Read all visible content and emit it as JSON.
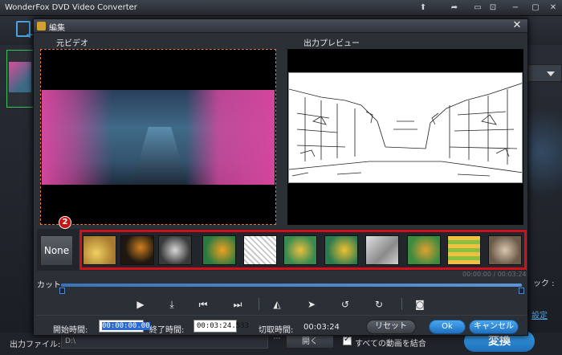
{
  "app": {
    "title": "WonderFox DVD Video Converter",
    "right_fragment": "ック :",
    "settings_link": "設定"
  },
  "bottom": {
    "output_label": "出力ファイル:",
    "output_path": "D:\\",
    "browse_label": "⋯",
    "open_label": "開く",
    "merge_label": "すべての動画を結合",
    "merge_checked": true,
    "convert_label": "変換"
  },
  "dialog": {
    "title": "編集",
    "close_label": "✕",
    "original_label": "元ビデオ",
    "preview_label": "出力プレビュー",
    "effects": {
      "none_label": "None",
      "badge": "2",
      "selected": "Edge",
      "thumb_icons": [
        "sepia-filter-icon",
        "dark-filter-icon",
        "grayscale-filter-icon",
        "vivid-filter-icon",
        "edge-filter-icon",
        "blur-filter-icon",
        "sharpen-filter-icon",
        "emboss-filter-icon",
        "noise-filter-icon",
        "mosaic-filter-icon",
        "aged-filter-icon"
      ]
    },
    "cut_label": "カット",
    "time_readout": "00:00:00 / 00:03:24",
    "trim_start_fraction": 0,
    "trim_end_fraction": 1,
    "controls": [
      "play-icon",
      "set-start-icon",
      "mark-start-icon",
      "mark-end-icon",
      "flip-horizontal-icon",
      "flip-vertical-icon",
      "rotate-left-icon",
      "rotate-right-icon",
      "snapshot-icon"
    ],
    "start_label": "開始時間:",
    "start_value": "00:00:00.00",
    "end_label": "終了時間:",
    "end_value": "00:03:24.533",
    "duration_label": "切取時間:",
    "duration_value": "00:03:24",
    "reset_label": "リセット",
    "ok_label": "Ok",
    "cancel_label": "キャンセル"
  },
  "colors": {
    "highlight_border": "#d1111a",
    "accent_blue": "#2a82d8",
    "selection_dash": "#e07a34"
  }
}
